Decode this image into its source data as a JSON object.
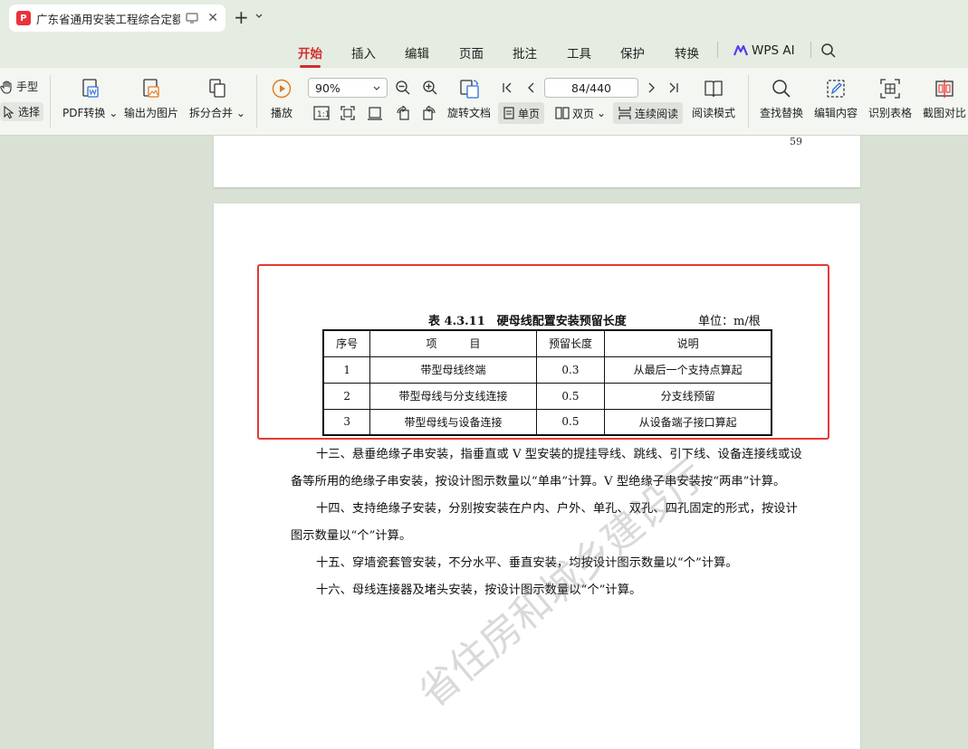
{
  "tab": {
    "title": "广东省通用安装工程综合定额",
    "logo": "P"
  },
  "menu": {
    "items": [
      {
        "label": "开始",
        "active": true
      },
      {
        "label": "插入"
      },
      {
        "label": "编辑"
      },
      {
        "label": "页面"
      },
      {
        "label": "批注"
      },
      {
        "label": "工具"
      },
      {
        "label": "保护"
      },
      {
        "label": "转换"
      }
    ],
    "ai_label": "WPS AI"
  },
  "toolbar": {
    "hand": "手型",
    "select": "选择",
    "pdf_convert": "PDF转换",
    "export_image": "输出为图片",
    "split_merge": "拆分合并",
    "play": "播放",
    "zoom": "90%",
    "rotate": "旋转文档",
    "single": "单页",
    "double": "双页",
    "continuous": "连续阅读",
    "reading_mode": "阅读模式",
    "page_indicator": "84/440",
    "find_replace": "查找替换",
    "edit_content": "编辑内容",
    "recognize_table": "识别表格",
    "screenshot_compare": "截图对比"
  },
  "document": {
    "prev_page_number": "59",
    "table": {
      "caption": "表 4.3.11　硬母线配置安装预留长度",
      "unit": "单位：m/根",
      "headers": [
        "序号",
        "项　　　目",
        "预留长度",
        "说明"
      ],
      "rows": [
        [
          "1",
          "带型母线终端",
          "0.3",
          "从最后一个支持点算起"
        ],
        [
          "2",
          "带型母线与分支线连接",
          "0.5",
          "分支线预留"
        ],
        [
          "3",
          "带型母线与设备连接",
          "0.5",
          "从设备端子接口算起"
        ]
      ]
    },
    "paragraphs": [
      "十三、悬垂绝缘子串安装，指垂直或 V 型安装的提挂导线、跳线、引下线、设备连接线或设备等所用的绝缘子串安装，按设计图示数量以“单串”计算。V 型绝缘子串安装按“两串”计算。",
      "十四、支持绝缘子安装，分别按安装在户内、户外、单孔、双孔、四孔固定的形式，按设计图示数量以“个”计算。",
      "十五、穿墙瓷套管安装，不分水平、垂直安装，均按设计图示数量以“个”计算。",
      "十六、母线连接器及堵头安装，按设计图示数量以“个”计算。"
    ],
    "watermark": "省住房和城乡建设厅"
  },
  "colors": {
    "accent": "#d52b2b",
    "highlight": "#e53935",
    "background": "#d9e1d5"
  }
}
